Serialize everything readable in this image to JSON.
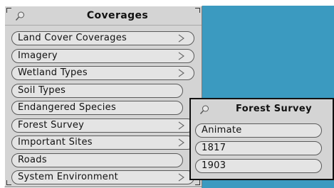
{
  "main_menu": {
    "title": "Coverages",
    "items": [
      {
        "label": "Land Cover Coverages",
        "submenu": true
      },
      {
        "label": "Imagery",
        "submenu": true
      },
      {
        "label": "Wetland Types",
        "submenu": true
      },
      {
        "label": "Soil Types",
        "submenu": false
      },
      {
        "label": "Endangered Species",
        "submenu": false
      },
      {
        "label": "Forest Survey",
        "submenu": true
      },
      {
        "label": "Important Sites",
        "submenu": true
      },
      {
        "label": "Roads",
        "submenu": false
      },
      {
        "label": "System Environment",
        "submenu": true
      }
    ]
  },
  "sub_menu": {
    "title": "Forest Survey",
    "items": [
      {
        "label": "Animate"
      },
      {
        "label": "1817"
      },
      {
        "label": "1903"
      }
    ]
  },
  "icons": {
    "pin": "pushpin-icon",
    "submenu_arrow": "submenu-arrow-icon"
  },
  "colors": {
    "desktop": "#3b9ac0",
    "menu_background": "#d4d4d4",
    "item_background": "#e4e4e4"
  }
}
